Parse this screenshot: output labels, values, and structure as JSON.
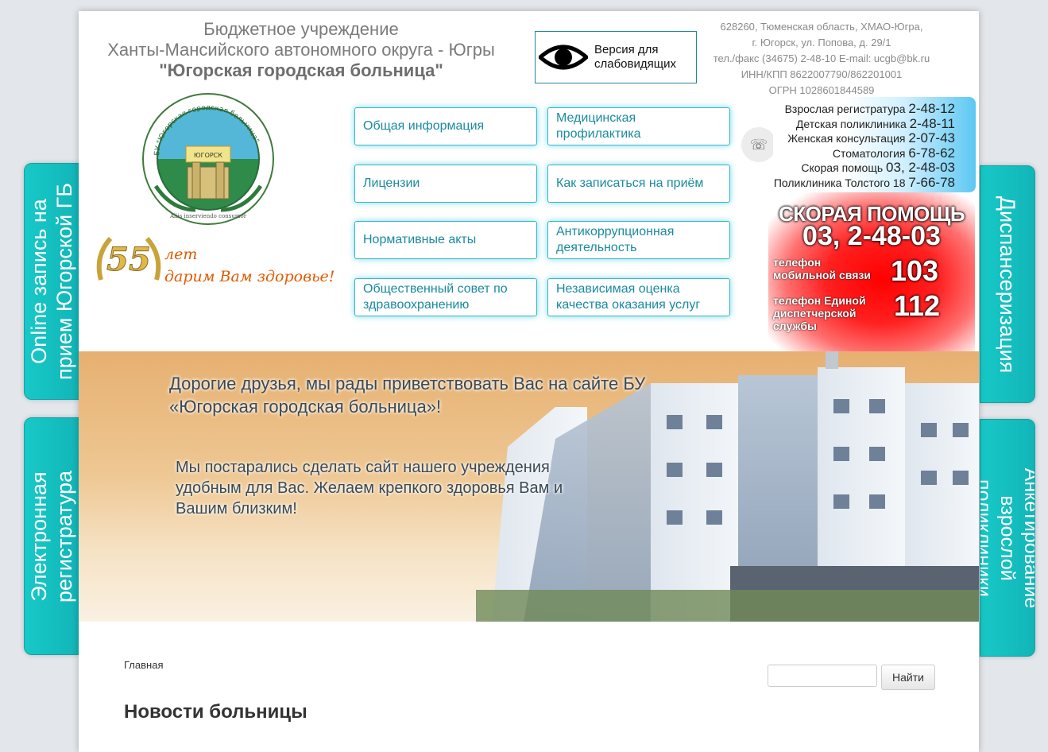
{
  "header": {
    "org_line1": "Бюджетное учреждение",
    "org_line2": "Ханты-Мансийского автономного округа - Югры",
    "org_line3": "\"Югорская городская больница\"",
    "low_vision_label": "Версия для слабовидящих",
    "address_line1": "628260, Тюменская область, ХМАО-Югра,",
    "address_line2": "г. Югорск, ул. Попова, д. 29/1",
    "contacts_line": "тел./факс (34675) 2-48-10 E-mail: ucgb@bk.ru",
    "inn_line": "ИНН/КПП 8622007790/862201001",
    "ogrn_line": "ОГРН 1028601844589"
  },
  "phones": [
    {
      "label": "Взрослая регистратура",
      "number": "2-48-12"
    },
    {
      "label": "Детская поликлиника",
      "number": "2-48-11"
    },
    {
      "label": "Женская консультация",
      "number": "2-07-43"
    },
    {
      "label": "Стоматология",
      "number": "6-78-62"
    },
    {
      "label": "Скорая помощь",
      "number": "03, 2-48-03"
    },
    {
      "label": "Поликлиника Толстого 18",
      "number": "7-66-78"
    }
  ],
  "emergency": {
    "title": "СКОРАЯ ПОМОЩЬ",
    "number": "03, 2-48-03",
    "mobile_label": "телефон мобильной связи",
    "mobile_number": "103",
    "unified_label": "телефон Единой диспетчерской службы",
    "unified_number": "112"
  },
  "logo": {
    "text_top": "БУ \"Югорская городская больница\"",
    "ribbon": "ЮГОРСК",
    "motto": "Aliis inserviendo consumor"
  },
  "anniversary": {
    "years": "55",
    "line1": "лет",
    "line2": "дарим Вам здоровье!"
  },
  "nav": [
    "Общая информация",
    "Медицинская профилактика",
    "Лицензии",
    "Как записаться на приём",
    "Нормативные акты",
    "Антикоррупционная деятельность",
    "Общественный совет по здравоохранению",
    "Независимая оценка качества оказания услуг"
  ],
  "banner": {
    "headline": "Дорогие друзья, мы рады приветствовать Вас на сайте БУ «Югорская городская больница»!",
    "subtext": "Мы постарались сделать сайт нашего учреждения удобным для Вас. Желаем крепкого здоровья Вам и Вашим близким!"
  },
  "side_tabs": {
    "left_top": "Online запись на прием Югорской ГБ",
    "left_bottom": "Электронная регистратура",
    "right_top": "Диспансеризация",
    "right_bottom": "Анкетирование взрослой поликлиники"
  },
  "content": {
    "breadcrumb": "Главная",
    "search_button": "Найти",
    "section_title": "Новости больницы"
  },
  "colors": {
    "accent": "#1a8aa0",
    "tab": "#17c9c7",
    "emergency": "#ff0000"
  }
}
